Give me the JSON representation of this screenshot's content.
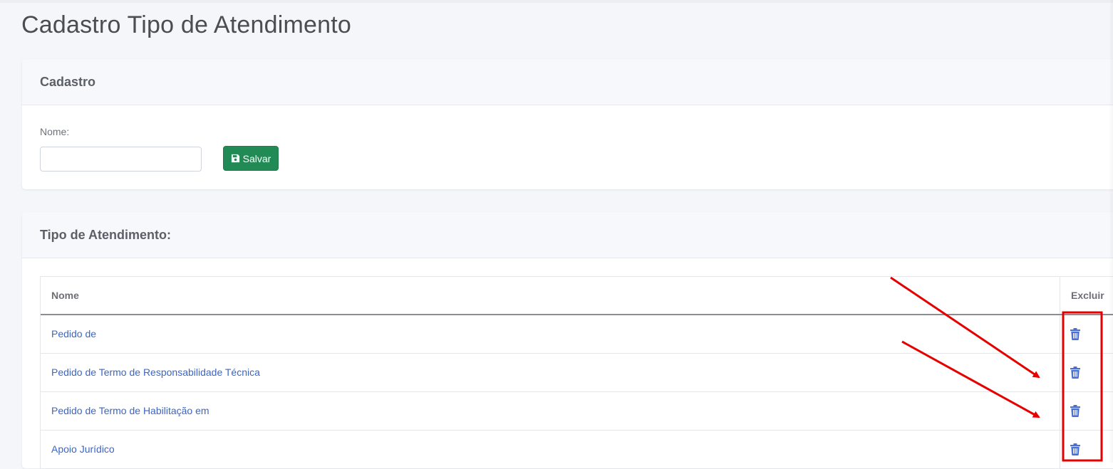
{
  "page": {
    "title": "Cadastro Tipo de Atendimento"
  },
  "cadastro": {
    "header": "Cadastro",
    "name_label": "Nome:",
    "name_value": "",
    "name_placeholder": "",
    "save_label": "Salvar",
    "save_icon": "floppy-disk-icon"
  },
  "tipo": {
    "header": "Tipo de Atendimento:",
    "columns": [
      "Nome",
      "Excluir"
    ],
    "rows": [
      {
        "name": "Pedido de",
        "action_icon": "trash-icon"
      },
      {
        "name": "Pedido de Termo de Responsabilidade Técnica",
        "action_icon": "trash-icon"
      },
      {
        "name": "Pedido de Termo de Habilitação em",
        "action_icon": "trash-icon"
      },
      {
        "name": "Apoio Jurídico",
        "action_icon": "trash-icon"
      }
    ]
  },
  "colors": {
    "accent_green": "#218a55",
    "link_blue": "#3b65c6",
    "annotation_red": "#e60000"
  }
}
